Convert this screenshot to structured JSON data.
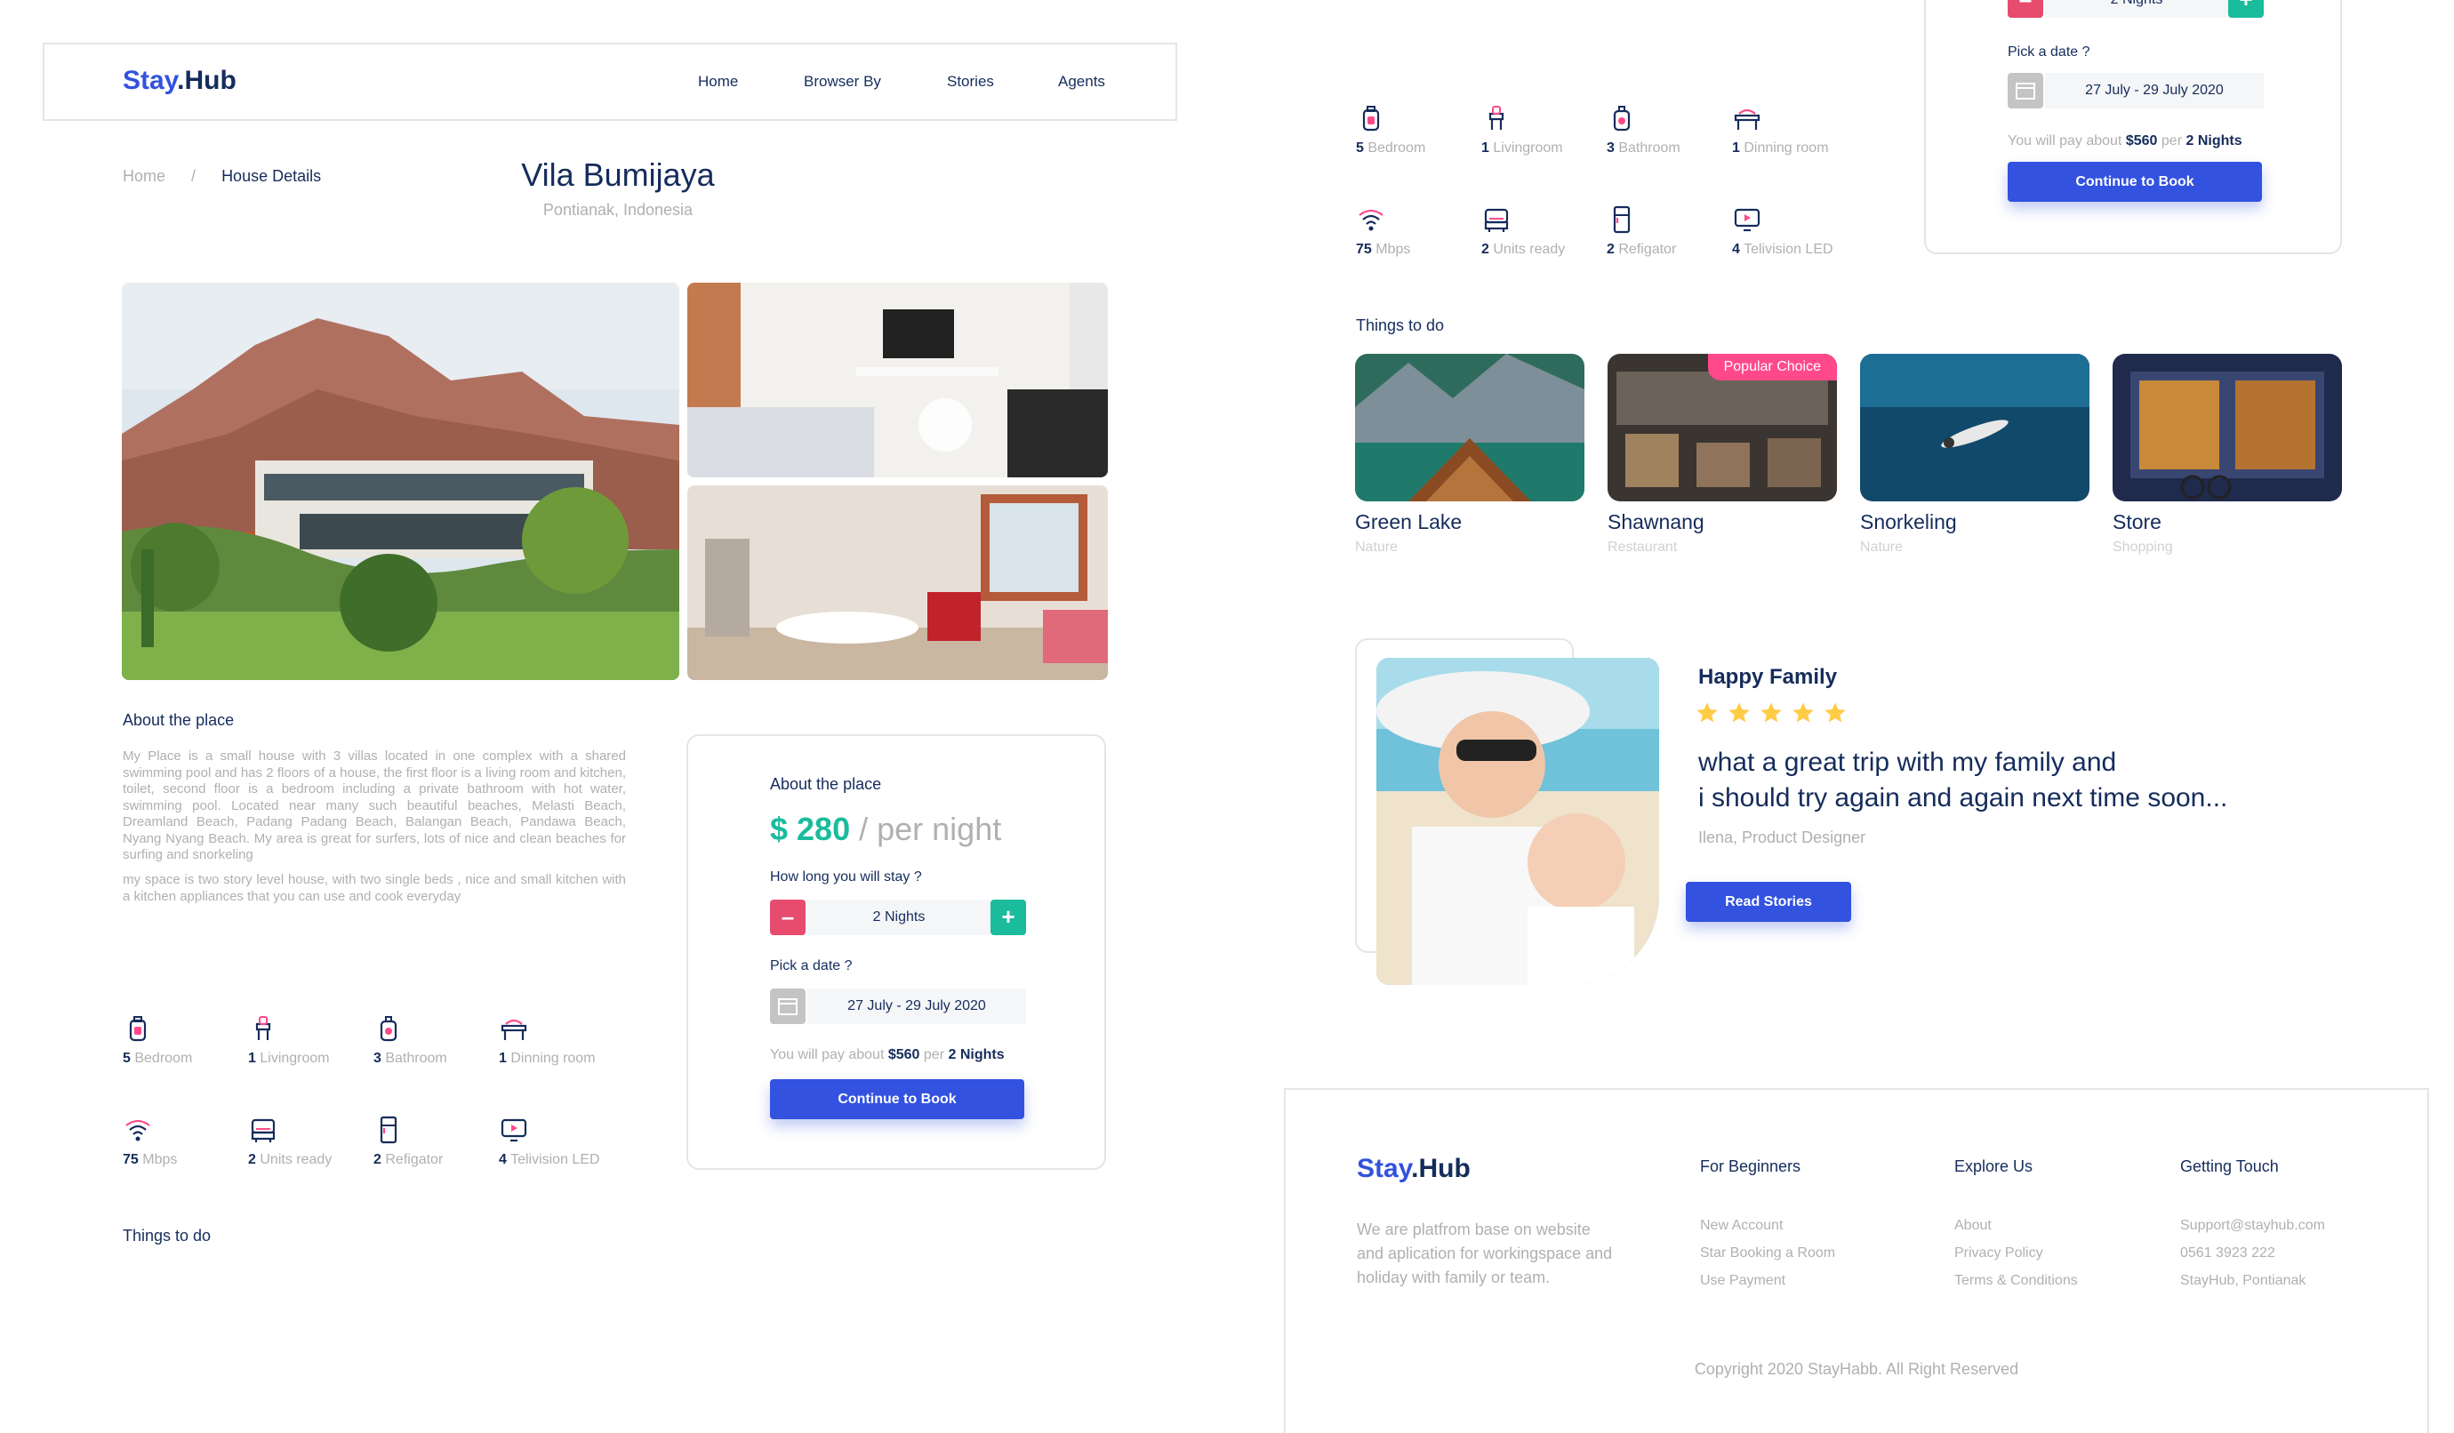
{
  "brand": {
    "part1": "Stay",
    "part2": ".Hub"
  },
  "nav": {
    "items": [
      "Home",
      "Browser By",
      "Stories",
      "Agents"
    ]
  },
  "breadcrumb": {
    "home": "Home",
    "sep": "/",
    "current": "House Details"
  },
  "property": {
    "title": "Vila Bumijaya",
    "location": "Pontianak, Indonesia"
  },
  "about": {
    "title": "About the place",
    "paragraph1": "My Place is a small house with 3 villas located in one complex with a shared swimming pool and has 2 floors of a house, the first floor is a living room and kitchen, toilet, second floor is a bedroom including a private bathroom with hot water, swimming pool. Located near many such beautiful beaches, Melasti Beach, Dreamland Beach, Padang Padang Beach, Balangan Beach, Pandawa Beach, Nyang Nyang Beach. My area is great for surfers, lots of nice and clean beaches for surfing and snorkeling",
    "paragraph2": "my space is two story level house, with two single beds , nice and small kitchen with a kitchen appliances that you can use and cook everyday"
  },
  "booking": {
    "title": "About the place",
    "price": "$ 280",
    "per": "/ per night",
    "duration_q": "How long you will stay ?",
    "minus": "–",
    "plus": "+",
    "nights": "2 Nights",
    "date_q": "Pick a date ?",
    "date": "27 July - 29 July 2020",
    "pay_pre": "You will pay about",
    "pay_amount": "$560",
    "pay_mid": "per",
    "pay_nights": "2 Nights",
    "cta": "Continue to Book"
  },
  "features": [
    {
      "icon": "bedroom-icon",
      "value": "5",
      "label": "Bedroom"
    },
    {
      "icon": "livingroom-icon",
      "value": "1",
      "label": "Livingroom"
    },
    {
      "icon": "bathroom-icon",
      "value": "3",
      "label": "Bathroom"
    },
    {
      "icon": "dining-room-icon",
      "value": "1",
      "label": "Dinning room"
    },
    {
      "icon": "wifi-icon",
      "value": "75",
      "label": "Mbps"
    },
    {
      "icon": "unit-icon",
      "value": "2",
      "label": "Units ready"
    },
    {
      "icon": "refrigerator-icon",
      "value": "2",
      "label": "Refigator"
    },
    {
      "icon": "television-icon",
      "value": "4",
      "label": "Telivision LED"
    }
  ],
  "things": {
    "title": "Things to do",
    "items": [
      {
        "name": "Green Lake",
        "category": "Nature",
        "badge": ""
      },
      {
        "name": "Shawnang",
        "category": "Restaurant",
        "badge": "Popular Choice"
      },
      {
        "name": "Snorkeling",
        "category": "Nature",
        "badge": ""
      },
      {
        "name": "Store",
        "category": "Shopping",
        "badge": ""
      }
    ]
  },
  "testimonial": {
    "title": "Happy Family",
    "stars": 5,
    "quote_line1": "what a great trip with my family and",
    "quote_line2": "i should try again and again next time soon...",
    "author": "Ilena, Product Designer",
    "cta": "Read Stories"
  },
  "footer": {
    "tagline": "We are platfrom  base on website and aplication for workingspace and holiday with family or team.",
    "columns": [
      {
        "title": "For Beginners",
        "links": [
          "New Account",
          "Star Booking a Room",
          "Use Payment"
        ]
      },
      {
        "title": "Explore Us",
        "links": [
          "About",
          "Privacy Policy",
          "Terms & Conditions"
        ]
      },
      {
        "title": "Getting Touch",
        "links": [
          "Support@stayhub.com",
          "0561 3923 222",
          "StayHub, Pontianak"
        ]
      }
    ],
    "copyright": "Copyright 2020 StayHabb. All Right Reserved"
  },
  "colors": {
    "primary": "#3252df",
    "navy": "#152c5b",
    "green": "#1abc9c",
    "pink": "#ff498b",
    "gray": "#b0b0b0",
    "star": "#ffcc47"
  }
}
